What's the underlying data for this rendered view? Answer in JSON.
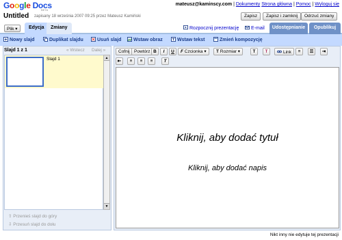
{
  "header": {
    "logo_letters": [
      "G",
      "o",
      "o",
      "g",
      "l",
      "e"
    ],
    "logo_docs": "Docs",
    "logo_sub": "BETA",
    "user_email": "mateusz@kaminscy.com",
    "sep": "|",
    "links": [
      "Dokumenty",
      "Strona główna",
      "Pomoc",
      "Wyloguj się"
    ],
    "doc_title": "Untitled",
    "doc_saved": "zapisany 18 września 2007 09:25 przez Mateusz Kamiński",
    "save": "Zapisz",
    "save_close": "Zapisz i zamknij",
    "discard": "Odrzuć zmiany"
  },
  "menu": {
    "file": "Plik ▾",
    "tab_edit": "Edycja",
    "tab_changes": "Zmiany",
    "start_presentation": "Rozpocznij prezentację",
    "email": "E-mail",
    "share": "Udostępnianie",
    "publish": "Opublikuj"
  },
  "slide_toolbar": {
    "new_slide": "Nowy slajd",
    "duplicate": "Duplikat slajdu",
    "delete": "Usuń slajd",
    "insert_image": "Wstaw obraz",
    "insert_text": "Wstaw tekst",
    "change_layout": "Zmień kompozycję"
  },
  "left_panel": {
    "slide_counter": "Slajd 1 z 1",
    "prev": "« Wstecz",
    "next": "Dalej »",
    "slide_label": "Slajd 1",
    "move_up": "Przenieś slajd do góry",
    "move_down": "Przesuń slajd do dołu"
  },
  "format_toolbar": {
    "undo": "Cofnij",
    "redo": "Powtórz",
    "bold": "B",
    "italic": "I",
    "underline": "U",
    "font": "Czcionka",
    "size": "Rozmiar",
    "link": "Link"
  },
  "canvas": {
    "title_placeholder": "Kliknij, aby dodać tytuł",
    "subtitle_placeholder": "Kliknij, aby dodać napis"
  },
  "status": "Nikt inny nie edytuje tej prezentacji",
  "colors": {
    "accent": "#c3d9ff",
    "link": "#0000cc",
    "tab_dark": "#6f91c7"
  }
}
